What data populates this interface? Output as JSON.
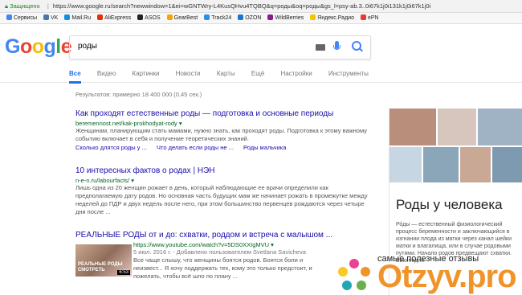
{
  "address_bar": {
    "security_label": "Защищено",
    "url": "https://www.google.ru/search?newwindow=1&ei=wGNTWry-L4KusQHvu4TQBQ&q=роды&oq=роды&gs_l=psy-ab.3..0i67k1j0i131k1j0i67k1j0i"
  },
  "bookmarks": [
    {
      "label": "Сервисы",
      "color": "#4285f4"
    },
    {
      "label": "VK",
      "color": "#4a76a8"
    },
    {
      "label": "Mail.Ru",
      "color": "#168de2"
    },
    {
      "label": "AliExpress",
      "color": "#e62e04"
    },
    {
      "label": "ASOS",
      "color": "#222222"
    },
    {
      "label": "GearBest",
      "color": "#f7a400"
    },
    {
      "label": "Track24",
      "color": "#2c8ee5"
    },
    {
      "label": "OZON",
      "color": "#1976d2"
    },
    {
      "label": "WildBerries",
      "color": "#8b1a8f"
    },
    {
      "label": "Яндекс.Радио",
      "color": "#f5c400"
    },
    {
      "label": "ePN",
      "color": "#e53935"
    }
  ],
  "search": {
    "logo": "Google",
    "query": "роды"
  },
  "tabs": [
    "Все",
    "Видео",
    "Картинки",
    "Новости",
    "Карты",
    "Ещё",
    "Настройки",
    "Инструменты"
  ],
  "stats": "Результатов: примерно 18 400 000 (0,45 сек.)",
  "results": [
    {
      "title": "Как проходят естественные роды — подготовка и основные периоды",
      "url": "beremennost.net/kak-prokhodyat-rody ▾",
      "snippet": "Женщинам, планирующим стать мамами, нужно знать, как проходят роды. Подготовка к этому важному событию включает в себя и получение теоретических знаний.",
      "sitelinks": [
        "Сколько длятся роды у ...",
        "Что делать если роды не ...",
        "Роды мальчика"
      ]
    },
    {
      "title": "10 интересных фактов о родах | НЭН",
      "url": "n-e-n.ru/labourfacts/ ▾",
      "snippet": "Лишь одна из 20 женщин рожает в день, который наблюдающие ее врачи определили как предполагаемую дату родов. Но основная часть будущих мам же начинает рожать в промежутке между неделей до ПДР и двух недель после него, при этом большинство первенцев рождаются через четыре дня после ..."
    },
    {
      "title": "РЕАЛЬНЫЕ РОДЫ от и до: схватки, роддом и встреча с малышом ...",
      "url": "https://www.youtube.com/watch?v=5DS0XXIgMVU ▾",
      "date": "5 июл. 2016 г. - Добавлено пользователем Svetlana Savicheva",
      "snippet": "Все чаще слышу, что женщины боятся родов. Боятся боли и неизвест... Я хочу поддержать тех, кому это только предстоит, и пожелать, чтобы всё шло по плану ...",
      "thumb_caption": "РЕАЛЬНЫЕ РОДЫ СМОТРЕТЬ",
      "duration": "6:53"
    }
  ],
  "knowledge_panel": {
    "title": "Роды у человека",
    "description": "Ро́ды — естественный физиологический процесс беременности и заключающийся в изгнании плода из матки через канал шейки матки и влагалища, или в случае родовыми путями. Начало родов предвещают схватки. Википедия"
  },
  "watermark": {
    "tagline": "самые полезные отзывы",
    "brand": "Otzyv.pro"
  }
}
